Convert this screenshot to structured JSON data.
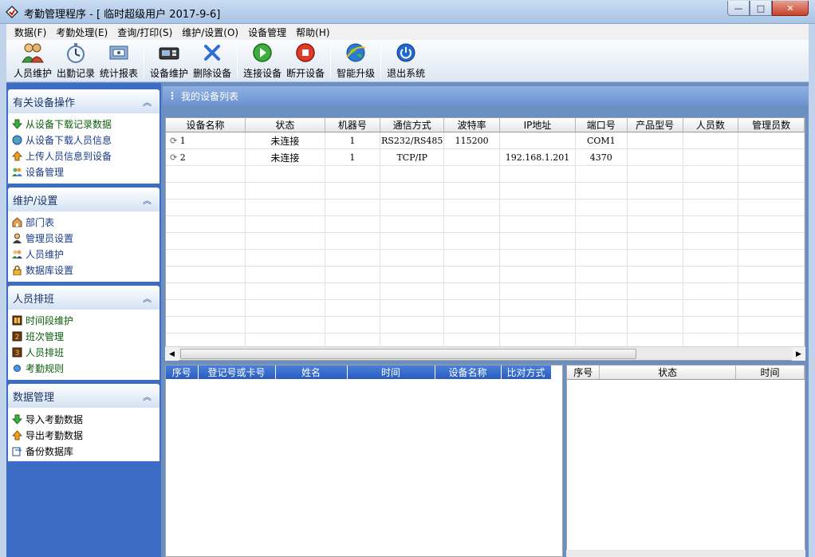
{
  "window": {
    "title": "考勤管理程序 - [ 临时超级用户 2017-9-6]",
    "minimize": "—",
    "maximize": "□",
    "close": "✕"
  },
  "menu": [
    "数据(F)",
    "考勤处理(E)",
    "查询/打印(S)",
    "维护/设置(O)",
    "设备管理",
    "帮助(H)"
  ],
  "toolbar": {
    "staff": "人员维护",
    "attendance_records": "出勤记录",
    "reports": "统计报表",
    "device_maint": "设备维护",
    "delete_device": "删除设备",
    "connect_device": "连接设备",
    "disconnect_device": "断开设备",
    "upgrade": "智能升级",
    "exit": "退出系统"
  },
  "sidebar": {
    "device_ops": {
      "title": "有关设备操作",
      "items": [
        "从设备下载记录数据",
        "从设备下载人员信息",
        "上传人员信息到设备",
        "设备管理"
      ]
    },
    "maint": {
      "title": "维护/设置",
      "items": [
        "部门表",
        "管理员设置",
        "人员维护",
        "数据库设置"
      ]
    },
    "schedule": {
      "title": "人员排班",
      "items": [
        "时间段维护",
        "班次管理",
        "人员排班",
        "考勤规则"
      ]
    },
    "data": {
      "title": "数据管理",
      "items": [
        "导入考勤数据",
        "导出考勤数据",
        "备份数据库"
      ]
    }
  },
  "device_list": {
    "title": "我的设备列表",
    "columns": [
      "设备名称",
      "状态",
      "机器号",
      "通信方式",
      "波特率",
      "IP地址",
      "端口号",
      "产品型号",
      "人员数",
      "管理员数"
    ],
    "rows": [
      {
        "name": "1",
        "status": "未连接",
        "machine": "1",
        "comm": "RS232/RS485",
        "baud": "115200",
        "ip": "",
        "port": "COM1"
      },
      {
        "name": "2",
        "status": "未连接",
        "machine": "1",
        "comm": "TCP/IP",
        "baud": "",
        "ip": "192.168.1.201",
        "port": "4370"
      }
    ]
  },
  "records": {
    "columns": [
      "序号",
      "登记号或卡号",
      "姓名",
      "时间",
      "设备名称",
      "比对方式"
    ]
  },
  "status_grid": {
    "columns": [
      "序号",
      "状态",
      "时间"
    ]
  }
}
